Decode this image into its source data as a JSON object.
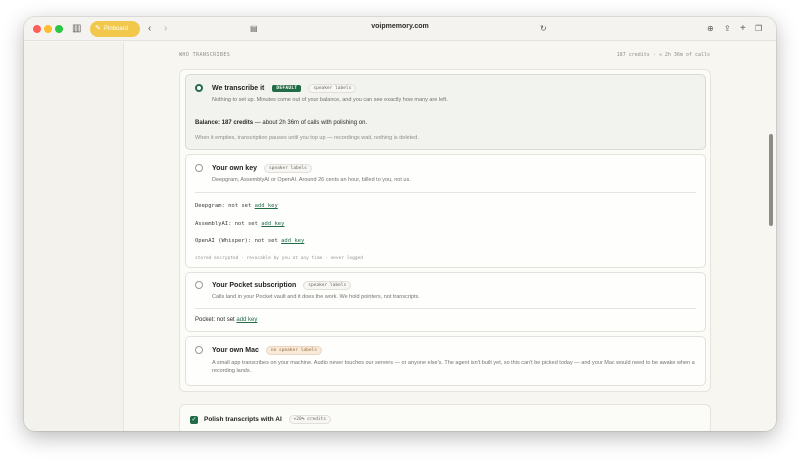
{
  "browser": {
    "tab_label": "Pinboard",
    "url": "voipmemory.com",
    "colors": {
      "tab": "#f1c84b",
      "red": "#fe5f57",
      "yellow": "#febc2e",
      "green": "#28c840"
    }
  },
  "section": {
    "label": "WHO TRANSCRIBES",
    "meta": "187 credits · ≈ 2h 36m of calls"
  },
  "options": [
    {
      "title": "We transcribe it",
      "badge": "DEFAULT",
      "tag": "speaker labels",
      "desc": "Nothing to set up. Minutes come out of your balance, and you can see exactly how many are left.",
      "balance_label": "Balance: 187 credits",
      "balance_rest": " — about 2h 36m of calls with polishing on.",
      "note": "When it empties, transcription pauses until you top up — recordings wait, nothing is deleted.",
      "selected": true
    },
    {
      "title": "Your own key",
      "tag": "speaker labels",
      "desc": "Deepgram, AssemblyAI or OpenAI. Around 26 cents an hour, billed to you, not us.",
      "keys": [
        {
          "label": "Deepgram:",
          "status": " not set ",
          "action": "add key"
        },
        {
          "label": "AssemblyAI:",
          "status": " not set ",
          "action": "add key"
        },
        {
          "label": "OpenAI (Whisper):",
          "status": " not set ",
          "action": "add key"
        }
      ],
      "footnote": "stored encrypted · revocable by you at any time · never logged"
    },
    {
      "title": "Your Pocket subscription",
      "tag": "speaker labels",
      "desc": "Calls land in your Pocket vault and it does the work. We hold pointers, not transcripts.",
      "key": {
        "label": "Pocket:",
        "status": " not set ",
        "action": "add key"
      }
    },
    {
      "title": "Your own Mac",
      "tag": "no speaker labels",
      "desc": "A small app transcribes on your machine. Audio never touches our servers — or anyone else's. The agent isn't built yet, so this can't be picked today — and your Mac would need to be awake when a recording lands."
    }
  ],
  "polish": {
    "label": "Polish transcripts with AI",
    "tag": "+20% credits",
    "checked": true
  },
  "accent_color": "#226b47"
}
